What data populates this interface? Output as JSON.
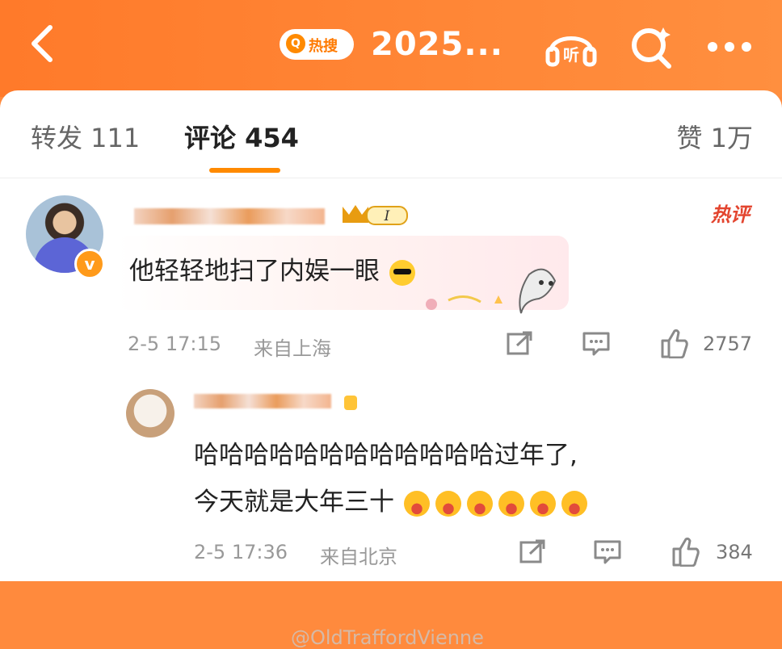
{
  "header": {
    "hot_search_label": "热搜",
    "hot_search_icon": "search-q-icon",
    "title": "2025...",
    "listen_label": "听",
    "accent": "#ff8a3d"
  },
  "tabs": {
    "repost": "转发 111",
    "comment": "评论 454",
    "like": "赞 1万",
    "active": "comment"
  },
  "comments": [
    {
      "badge": "I",
      "hot_label": "热评",
      "text": "他轻轻地扫了内娱一眼",
      "time": "2-5 17:15",
      "location": "来自上海",
      "like_count": "2757"
    },
    {
      "text_line1": "哈哈哈哈哈哈哈哈哈哈哈哈过年了,",
      "text_line2": "今天就是大年三十",
      "time": "2-5 17:36",
      "location": "来自北京",
      "like_count": "384"
    }
  ],
  "watermark": "@OldTraffordVienne"
}
